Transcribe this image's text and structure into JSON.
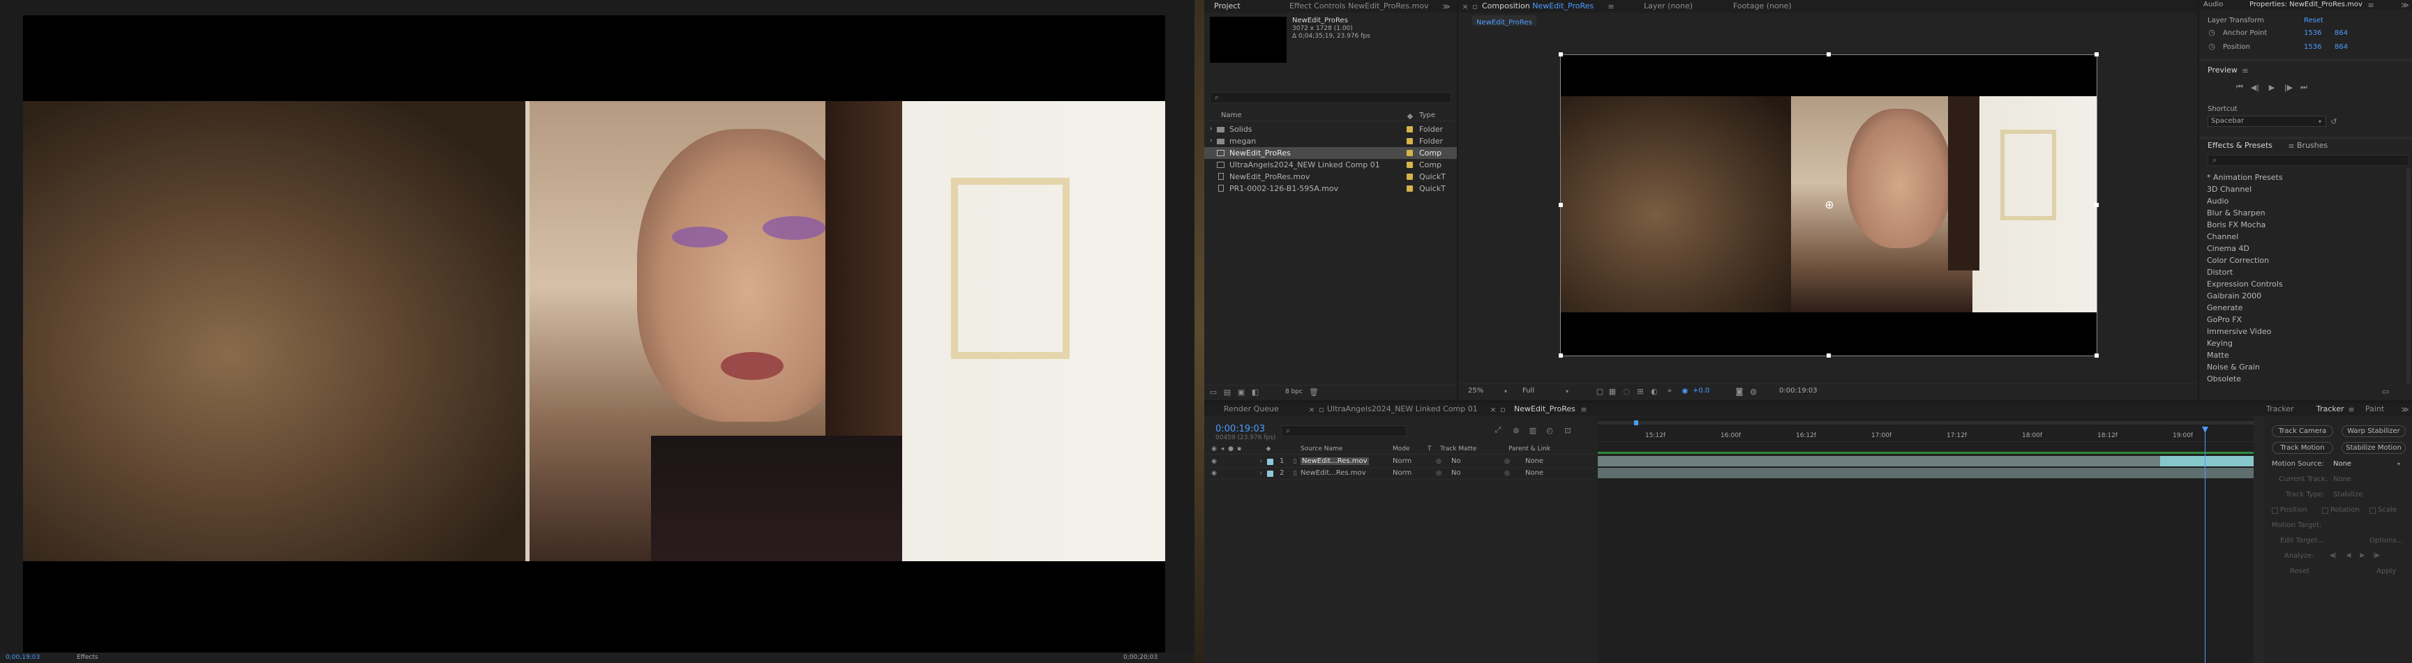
{
  "viewer_left": {
    "status_timecode": "0;00;19;03",
    "status_left_label": "Effects",
    "status_right": "0;00;20;03"
  },
  "project": {
    "tabs": [
      "Project",
      "Effect Controls NewEdit_ProRes.mov"
    ],
    "thumb_name": "NewEdit_ProRes",
    "thumb_dims": "3072 x 1728 (1.00)",
    "thumb_duration": "Δ 0;04;35;19, 23.976 fps",
    "search_placeholder": "",
    "col_name": "Name",
    "col_type": "Type",
    "items": [
      {
        "name": "Solids",
        "type": "Folder",
        "color": "#d6b44a"
      },
      {
        "name": "megan",
        "type": "Folder",
        "color": "#d6b44a"
      },
      {
        "name": "NewEdit_ProRes",
        "type": "Comp",
        "color": "#d6b44a"
      },
      {
        "name": "UltraAngels2024_NEW Linked Comp 01",
        "type": "Comp",
        "color": "#d6b44a"
      },
      {
        "name": "NewEdit_ProRes.mov",
        "type": "QuickT",
        "color": "#d6b44a"
      },
      {
        "name": "PR1-0002-126-B1-595A.mov",
        "type": "QuickT",
        "color": "#d6b44a"
      }
    ],
    "bpc": "8 bpc"
  },
  "composition": {
    "tabs": [
      "Composition NewEdit_ProRes",
      "Layer (none)",
      "Footage (none)"
    ],
    "active_tab_prefix": "Composition",
    "active_tab_name": "NewEdit_ProRes",
    "breadcrumb": "NewEdit_ProRes",
    "zoom": "25%",
    "resolution": "Full",
    "exposure": "+0.0",
    "timecode": "0:00:19:03"
  },
  "properties": {
    "tabs": [
      "Audio",
      "Properties: NewEdit_ProRes.mov"
    ],
    "section": "Layer Transform",
    "reset": "Reset",
    "anchor_label": "Anchor Point",
    "anchor_x": "1536",
    "anchor_y": "864",
    "position_label": "Position",
    "position_x": "1536",
    "position_y": "864"
  },
  "preview": {
    "title": "Preview",
    "shortcut_label": "Shortcut",
    "shortcut_value": "Spacebar"
  },
  "effects": {
    "tabs": [
      "Effects & Presets",
      "Brushes"
    ],
    "search_placeholder": "",
    "categories": [
      "* Animation Presets",
      "3D Channel",
      "Audio",
      "Blur & Sharpen",
      "Boris FX Mocha",
      "Channel",
      "Cinema 4D",
      "Color Correction",
      "Distort",
      "Expression Controls",
      "Gaibrain 2000",
      "Generate",
      "GoPro FX",
      "Immersive Video",
      "Keying",
      "Matte",
      "Noise & Grain",
      "Obsolete"
    ]
  },
  "timeline": {
    "tabs": [
      "Render Queue",
      "UltraAngels2024_NEW Linked Comp 01",
      "NewEdit_ProRes"
    ],
    "timecode": "0:00:19:03",
    "timecode_sub": "00459 (23.976 fps)",
    "columns": {
      "source": "Source Name",
      "mode": "Mode",
      "t": "T",
      "trackmatte": "Track Matte",
      "parent": "Parent & Link"
    },
    "layers": [
      {
        "num": "1",
        "name": "NewEdit...Res.mov",
        "mode": "Norm",
        "matte": "No",
        "parent": "None"
      },
      {
        "num": "2",
        "name": "NewEdit...Res.mov",
        "mode": "Norm",
        "matte": "No",
        "parent": "None"
      }
    ],
    "ruler": [
      "15:12f",
      "16:00f",
      "16:12f",
      "17:00f",
      "17:12f",
      "18:00f",
      "18:12f",
      "19:00f"
    ]
  },
  "tracker": {
    "tabs": [
      "Tracker",
      "Tracker",
      "Paint"
    ],
    "track_camera": "Track Camera",
    "warp_stabilizer": "Warp Stabilizer",
    "track_motion": "Track Motion",
    "stabilize_motion": "Stabilize Motion",
    "motion_source_label": "Motion Source:",
    "motion_source_value": "None",
    "current_track_label": "Current Track:",
    "current_track_value": "None",
    "track_type_label": "Track Type:",
    "track_type_value": "Stabilize",
    "position": "Position",
    "rotation": "Rotation",
    "scale": "Scale",
    "motion_target": "Motion Target:",
    "edit_target": "Edit Target...",
    "options": "Options...",
    "analyze": "Analyze:",
    "reset": "Reset",
    "apply": "Apply"
  }
}
